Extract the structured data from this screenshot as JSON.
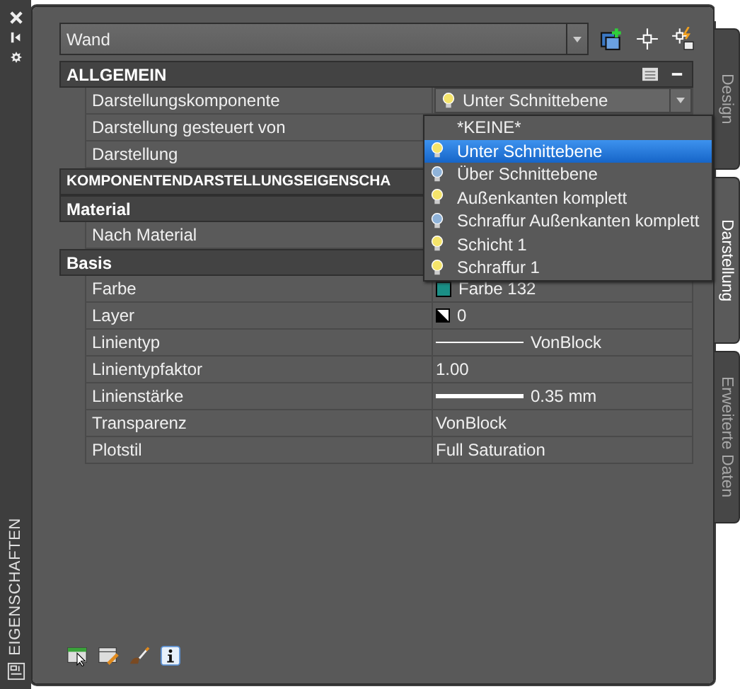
{
  "palette_title": "EIGENSCHAFTEN",
  "object_type": {
    "value": "Wand"
  },
  "sections": [
    {
      "title": "ALLGEMEIN",
      "rows": [
        {
          "label": "Darstellungskomponente",
          "kind": "dropdown",
          "value": "Unter Schnittebene",
          "lit": true
        },
        {
          "label": "Darstellung gesteuert von"
        },
        {
          "label": "Darstellung"
        }
      ]
    },
    {
      "title": "KOMPONENTENDARSTELLUNGSEIGENSCHA"
    },
    {
      "title": "Material",
      "rows": [
        {
          "label": "Nach Material"
        }
      ]
    },
    {
      "title": "Basis",
      "rows": [
        {
          "label": "Farbe",
          "kind": "color",
          "value": "Farbe 132"
        },
        {
          "label": "Layer",
          "kind": "layer",
          "value": "0"
        },
        {
          "label": "Linientyp",
          "kind": "linetype",
          "value": "VonBlock"
        },
        {
          "label": "Linientypfaktor",
          "kind": "text",
          "value": "1.00"
        },
        {
          "label": "Linienstärke",
          "kind": "lineweight",
          "value": "0.35 mm"
        },
        {
          "label": "Transparenz",
          "kind": "text",
          "value": "VonBlock"
        },
        {
          "label": "Plotstil",
          "kind": "text",
          "value": "Full Saturation"
        }
      ]
    }
  ],
  "dropdown_list": [
    {
      "label": "*KEINE*",
      "selected": false
    },
    {
      "label": "Unter Schnittebene",
      "selected": true,
      "lit": true
    },
    {
      "label": "Über Schnittebene",
      "selected": false,
      "lit": false
    },
    {
      "label": "Außenkanten komplett",
      "selected": false,
      "lit": true
    },
    {
      "label": "Schraffur Außenkanten komplett",
      "selected": false,
      "lit": false
    },
    {
      "label": "Schicht 1",
      "selected": false,
      "lit": true
    },
    {
      "label": "Schraffur 1",
      "selected": false,
      "lit": true
    }
  ],
  "tabs": [
    {
      "label": "Design",
      "selected": false
    },
    {
      "label": "Darstellung",
      "selected": true
    },
    {
      "label": "Erweiterte Daten",
      "selected": false
    }
  ]
}
